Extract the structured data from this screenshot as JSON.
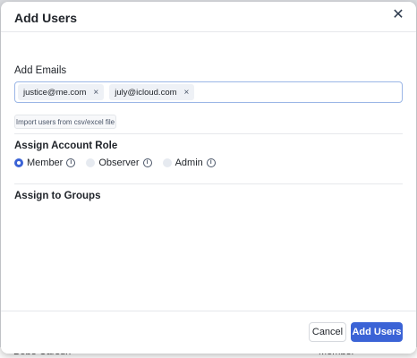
{
  "modal": {
    "title": "Add Users",
    "close_icon": "close-icon"
  },
  "emails": {
    "label": "Add Emails",
    "chips": [
      {
        "email": "justice@me.com"
      },
      {
        "email": "july@icloud.com"
      }
    ],
    "chip_remove_glyph": "×"
  },
  "import": {
    "label": "Import users from csv/excel file"
  },
  "roles": {
    "label": "Assign Account Role",
    "options": [
      {
        "label": "Member",
        "selected": true
      },
      {
        "label": "Observer",
        "selected": false
      },
      {
        "label": "Admin",
        "selected": false
      }
    ],
    "info_icon": "info-icon"
  },
  "groups": {
    "label": "Assign to Groups"
  },
  "footer": {
    "cancel_label": "Cancel",
    "add_label": "Add Users"
  },
  "background": {
    "row_name": "Bobe Carsdn",
    "row_role": "Member"
  },
  "colors": {
    "accent": "#3b63d6",
    "chip_bg": "#eef1f6",
    "input_border": "#9bb6e6"
  }
}
